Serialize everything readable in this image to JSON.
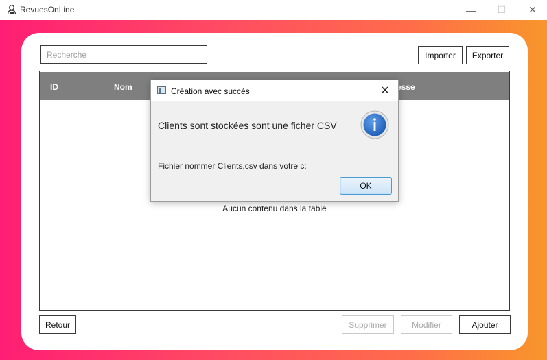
{
  "window": {
    "title": "RevuesOnLine",
    "app_icon": "user-icon",
    "minimize_glyph": "—",
    "maximize_glyph": "☐",
    "close_glyph": "✕"
  },
  "toolbar": {
    "search_placeholder": "Recherche",
    "search_value": "",
    "import_label": "Importer",
    "export_label": "Exporter"
  },
  "table": {
    "columns": [
      "ID",
      "Nom",
      "esse"
    ],
    "rows": [],
    "empty_text": "Aucun contenu dans la table"
  },
  "footer": {
    "back_label": "Retour",
    "delete_label": "Supprimer",
    "edit_label": "Modifier",
    "add_label": "Ajouter"
  },
  "dialog": {
    "title": "Création avec succès",
    "header": "Clients sont stockées sont une ficher CSV",
    "content": "Fichier nommer Clients.csv dans votre c:",
    "ok_label": "OK",
    "close_glyph": "✕",
    "icon": "info-icon"
  },
  "colors": {
    "gradient_start": "#ff1e74",
    "gradient_end": "#f8962b",
    "table_header": "#7f7f7f",
    "info_blue": "#2a6dc4"
  }
}
